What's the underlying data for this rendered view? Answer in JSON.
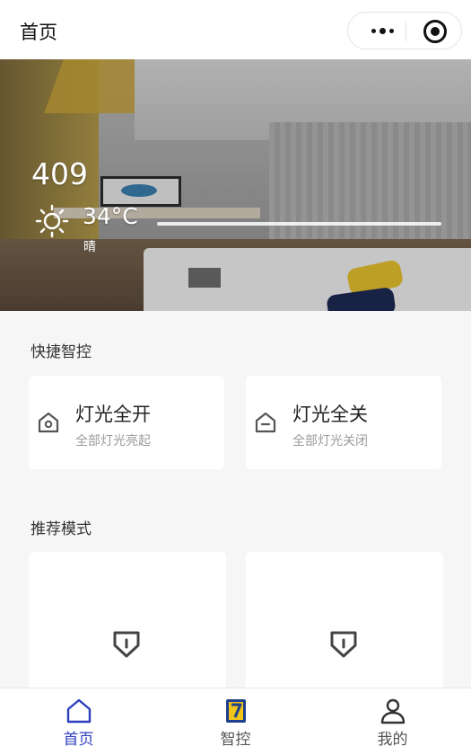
{
  "header": {
    "title": "首页",
    "more_icon": "more-dots-icon",
    "close_icon": "target-icon"
  },
  "banner": {
    "room_number": "409",
    "temperature": "34°C",
    "weather": "晴",
    "weather_icon": "sun-icon"
  },
  "quick_control": {
    "section_title": "快捷智控",
    "items": [
      {
        "name": "灯光全开",
        "desc": "全部灯光亮起",
        "icon": "home-plus-icon"
      },
      {
        "name": "灯光全关",
        "desc": "全部灯光关闭",
        "icon": "home-minus-icon"
      }
    ]
  },
  "recommended": {
    "section_title": "推荐模式",
    "items": [
      {
        "icon": "shield-icon"
      },
      {
        "icon": "shield-icon"
      }
    ]
  },
  "tabbar": {
    "items": [
      {
        "label": "首页",
        "icon": "home-icon",
        "active": true
      },
      {
        "label": "智控",
        "icon": "smart-control-icon",
        "active": false
      },
      {
        "label": "我的",
        "icon": "user-icon",
        "active": false
      }
    ],
    "active_color": "#2c3fbf",
    "inactive_color": "#555555"
  }
}
